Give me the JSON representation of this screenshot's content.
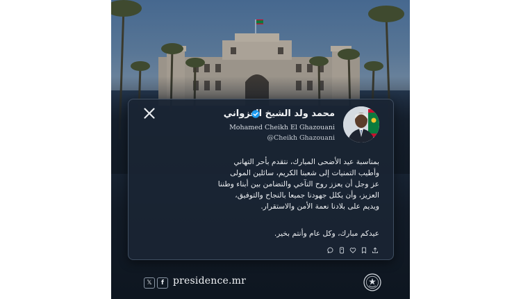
{
  "post": {
    "name_ar": "محمد ولد الشيخ الغزواني",
    "name_latin": "Mohamed Cheikh El Ghazouani",
    "handle": "@Cheikh Ghazouani",
    "body_lines": [
      "بمناسبة عيد الأضحى المبارك، نتقدم بأحر التهاني",
      "وأطيب التمنيات إلى شعبنا الكريم، سائلين المولى",
      "عز وجل أن يعزز روح التآخي والتضامن بين أبناء وطننا",
      "العزيز، وأن يكلل جهودنا جميعا بالنجاح والتوفيق،",
      "ويديم على بلادنا نعمة الأمن والاستقرار."
    ],
    "closing": "عيدكم مبارك، وكل عام وأنتم بخير."
  },
  "footer": {
    "site": "presidence.mr",
    "x_glyph": "𝕏",
    "fb_glyph": "f"
  },
  "icons": {
    "header": "x-logo-icon",
    "verified": "verified-badge-icon",
    "actions": [
      "reply-icon",
      "repost-icon",
      "like-icon",
      "bookmark-icon",
      "share-icon"
    ]
  },
  "colors": {
    "card": "#1a2534",
    "verified": "#1d9bf0",
    "flag_green": "#0b7a3e",
    "flag_red": "#c8102e",
    "flag_gold": "#f4c430"
  }
}
